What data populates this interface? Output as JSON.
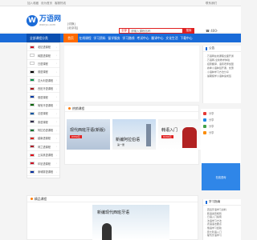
{
  "topbar": {
    "links": [
      "加入收藏",
      "设为首页",
      "客服热线"
    ],
    "right": "联系我们"
  },
  "logo": {
    "cn": "万语网",
    "en": "wanyu.com"
  },
  "location": {
    "line1": "[切换]",
    "line2": "[北京站]"
  },
  "search": {
    "select_label": "全部",
    "placeholder": "请输入课程名称",
    "button_label": "搜索"
  },
  "phone": "☎ 400-",
  "nav": {
    "all_label": "全部课程分类",
    "items": [
      "首页",
      "在线课程",
      "学习资料",
      "留学服务",
      "学习路线",
      "考试中心",
      "翻译中心",
      "文化生活",
      "下载中心"
    ]
  },
  "sidebar": {
    "languages": [
      {
        "label": "老挝语课程",
        "flag": "#ce1126"
      },
      {
        "label": "韩国语课程",
        "flag": "#ffffff"
      },
      {
        "label": "日语课程",
        "flag": "#ffffff"
      },
      {
        "label": "德语课程",
        "flag": "#000000"
      },
      {
        "label": "意大利语课程",
        "flag": "#009246"
      },
      {
        "label": "西班牙语课程",
        "flag": "#aa151b"
      },
      {
        "label": "俄语课程",
        "flag": "#0039a6"
      },
      {
        "label": "葡萄牙语课程",
        "flag": "#006600"
      },
      {
        "label": "法语课程",
        "flag": "#0055a4"
      },
      {
        "label": "泰语课程",
        "flag": "#2d2a4a"
      },
      {
        "label": "阿拉伯语课程",
        "flag": "#00732f"
      },
      {
        "label": "越南语课程",
        "flag": "#da251d"
      },
      {
        "label": "荷兰语课程",
        "flag": "#ae1c28"
      },
      {
        "label": "土耳其语课程",
        "flag": "#e30a17"
      },
      {
        "label": "印尼语课程",
        "flag": "#ce1126"
      },
      {
        "label": "柬埔寨语课程",
        "flag": "#032ea1"
      }
    ]
  },
  "notice": {
    "title": "公告",
    "items": [
      "· 万语网在线课程全面开通",
      "· 万语网-全新教学体验",
      "",
      "",
      "· 招募翻译、语音老师加盟",
      "· 春季小语种班开课，优惠",
      "· 小语种学习方法分享",
      "· 暑期留学小语种速成班"
    ]
  },
  "hot": {
    "title": "热销课程",
    "cards": [
      {
        "text": "现代西班牙语(新版)",
        "price": "¥350元"
      },
      {
        "text": "新编阿拉伯语",
        "price": "第一册"
      },
      {
        "text": "韩语入门",
        "price": "¥290元"
      }
    ]
  },
  "share": {
    "items": [
      {
        "label": "分享",
        "color": "#e53935"
      },
      {
        "label": "分享",
        "color": "#1e88e5"
      },
      {
        "label": "分享",
        "color": "#43a047"
      },
      {
        "label": "分享",
        "color": "#fb8c00"
      }
    ]
  },
  "feedback": "在线咨询",
  "boutique": {
    "title": "精品课程",
    "image_text": "新编现代西班牙语"
  },
  "study": {
    "title": "学习指南",
    "items": [
      "· 西班牙语学习资料",
      "· 韩语发音规则",
      "· 日语入门指南",
      "· 法语学习方法",
      "· 德语语法要点",
      "· 俄语学习经验",
      "· 意大利语入门",
      "· 葡萄牙语学习"
    ]
  }
}
